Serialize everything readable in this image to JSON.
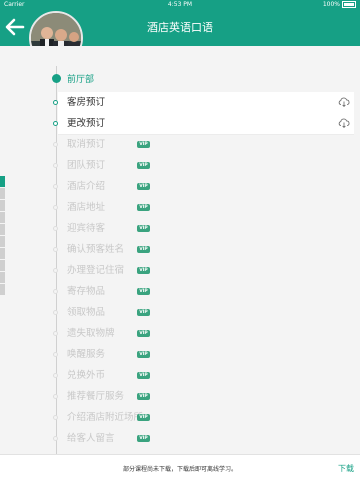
{
  "status_bar": {
    "carrier": "Carrier",
    "time": "4:53 PM",
    "battery": "100%"
  },
  "header": {
    "title": "酒店英语口语",
    "back_icon": "arrow-left-icon"
  },
  "colors": {
    "accent": "#16a085",
    "vip_badge": "#3aa37f",
    "locked_text": "#c8c8c8"
  },
  "section": {
    "title": "前厅部"
  },
  "items": [
    {
      "label": "客房预订",
      "locked": false,
      "vip": "",
      "icon": "cloud-download-icon"
    },
    {
      "label": "更改预订",
      "locked": false,
      "vip": "",
      "icon": "cloud-download-icon"
    },
    {
      "label": "取消预订",
      "locked": true,
      "vip": "VIP"
    },
    {
      "label": "团队预订",
      "locked": true,
      "vip": "VIP"
    },
    {
      "label": "酒店介绍",
      "locked": true,
      "vip": "VIP"
    },
    {
      "label": "酒店地址",
      "locked": true,
      "vip": "VIP"
    },
    {
      "label": "迎宾待客",
      "locked": true,
      "vip": "VIP"
    },
    {
      "label": "确认预客姓名",
      "locked": true,
      "vip": "VIP"
    },
    {
      "label": "办理登记住宿",
      "locked": true,
      "vip": "VIP"
    },
    {
      "label": "寄存物品",
      "locked": true,
      "vip": "VIP"
    },
    {
      "label": "领取物品",
      "locked": true,
      "vip": "VIP"
    },
    {
      "label": "遗失取物牌",
      "locked": true,
      "vip": "VIP"
    },
    {
      "label": "唤醒服务",
      "locked": true,
      "vip": "VIP"
    },
    {
      "label": "兑换外币",
      "locked": true,
      "vip": "VIP"
    },
    {
      "label": "推荐餐厅服务",
      "locked": true,
      "vip": "VIP"
    },
    {
      "label": "介绍酒店附近场所",
      "locked": true,
      "vip": "VIP"
    },
    {
      "label": "给客人留言",
      "locked": true,
      "vip": "VIP"
    }
  ],
  "footer": {
    "message": "部分课程尚未下载，下载后即可离线学习。",
    "download_label": "下载"
  }
}
